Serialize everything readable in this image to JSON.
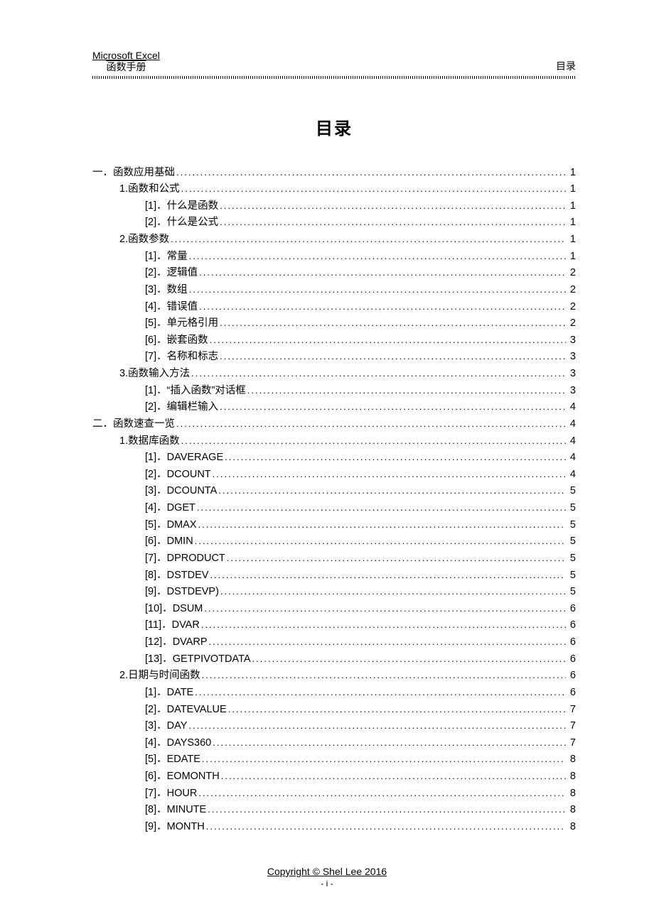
{
  "header": {
    "left_line1": "Microsoft Excel",
    "left_line2": "函数手册",
    "right": "目录"
  },
  "title": "目录",
  "toc": [
    {
      "level": 1,
      "label": "一．函数应用基础",
      "page": "1"
    },
    {
      "level": 2,
      "label": "1.函数和公式",
      "page": "1"
    },
    {
      "level": 3,
      "label": "[1]．什么是函数",
      "page": "1"
    },
    {
      "level": 3,
      "label": "[2]．什么是公式",
      "page": "1"
    },
    {
      "level": 2,
      "label": "2.函数参数",
      "page": "1"
    },
    {
      "level": 3,
      "label": "[1]．常量",
      "page": "1"
    },
    {
      "level": 3,
      "label": "[2]．逻辑值",
      "page": "2"
    },
    {
      "level": 3,
      "label": "[3]．数组",
      "page": "2"
    },
    {
      "level": 3,
      "label": "[4]．错误值",
      "page": "2"
    },
    {
      "level": 3,
      "label": "[5]．单元格引用",
      "page": "2"
    },
    {
      "level": 3,
      "label": "[6]．嵌套函数",
      "page": "3"
    },
    {
      "level": 3,
      "label": "[7]．名称和标志",
      "page": "3"
    },
    {
      "level": 2,
      "label": "3.函数输入方法",
      "page": "3"
    },
    {
      "level": 3,
      "label": "[1]．“插入函数”对话框",
      "page": "3"
    },
    {
      "level": 3,
      "label": "[2]．编辑栏输入",
      "page": "4"
    },
    {
      "level": 1,
      "label": "二．函数速查一览",
      "page": "4"
    },
    {
      "level": 2,
      "label": "1.数据库函数",
      "page": "4"
    },
    {
      "level": 3,
      "label": "[1]．DAVERAGE",
      "page": "4"
    },
    {
      "level": 3,
      "label": "[2]．DCOUNT",
      "page": "4"
    },
    {
      "level": 3,
      "label": "[3]．DCOUNTA",
      "page": "5"
    },
    {
      "level": 3,
      "label": "[4]．DGET",
      "page": "5"
    },
    {
      "level": 3,
      "label": "[5]．DMAX",
      "page": "5"
    },
    {
      "level": 3,
      "label": "[6]．DMIN",
      "page": "5"
    },
    {
      "level": 3,
      "label": "[7]．DPRODUCT",
      "page": "5"
    },
    {
      "level": 3,
      "label": "[8]．DSTDEV",
      "page": "5"
    },
    {
      "level": 3,
      "label": "[9]．DSTDEVP)",
      "page": "5"
    },
    {
      "level": 3,
      "wide": true,
      "prefix": "[10]．",
      "name": "DSUM",
      "page": "6"
    },
    {
      "level": 3,
      "wide": true,
      "prefix": "[11]．",
      "name": "DVAR",
      "page": "6"
    },
    {
      "level": 3,
      "wide": true,
      "prefix": "[12]．",
      "name": "DVARP",
      "page": "6"
    },
    {
      "level": 3,
      "wide": true,
      "prefix": "[13]．",
      "name": "GETPIVOTDATA",
      "page": "6"
    },
    {
      "level": 2,
      "label": "2.日期与时间函数",
      "page": "6"
    },
    {
      "level": 3,
      "label": "[1]．DATE",
      "page": "6"
    },
    {
      "level": 3,
      "label": "[2]．DATEVALUE",
      "page": "7"
    },
    {
      "level": 3,
      "label": "[3]．DAY",
      "page": "7"
    },
    {
      "level": 3,
      "label": "[4]．DAYS360",
      "page": "7"
    },
    {
      "level": 3,
      "label": "[5]．EDATE",
      "page": "8"
    },
    {
      "level": 3,
      "label": "[6]．EOMONTH",
      "page": "8"
    },
    {
      "level": 3,
      "label": "[7]．HOUR",
      "page": "8"
    },
    {
      "level": 3,
      "label": "[8]．MINUTE",
      "page": "8"
    },
    {
      "level": 3,
      "label": "[9]．MONTH",
      "page": "8"
    }
  ],
  "footer": {
    "copyright": "Copyright © Shel Lee 2016",
    "page_label": "- i -"
  }
}
